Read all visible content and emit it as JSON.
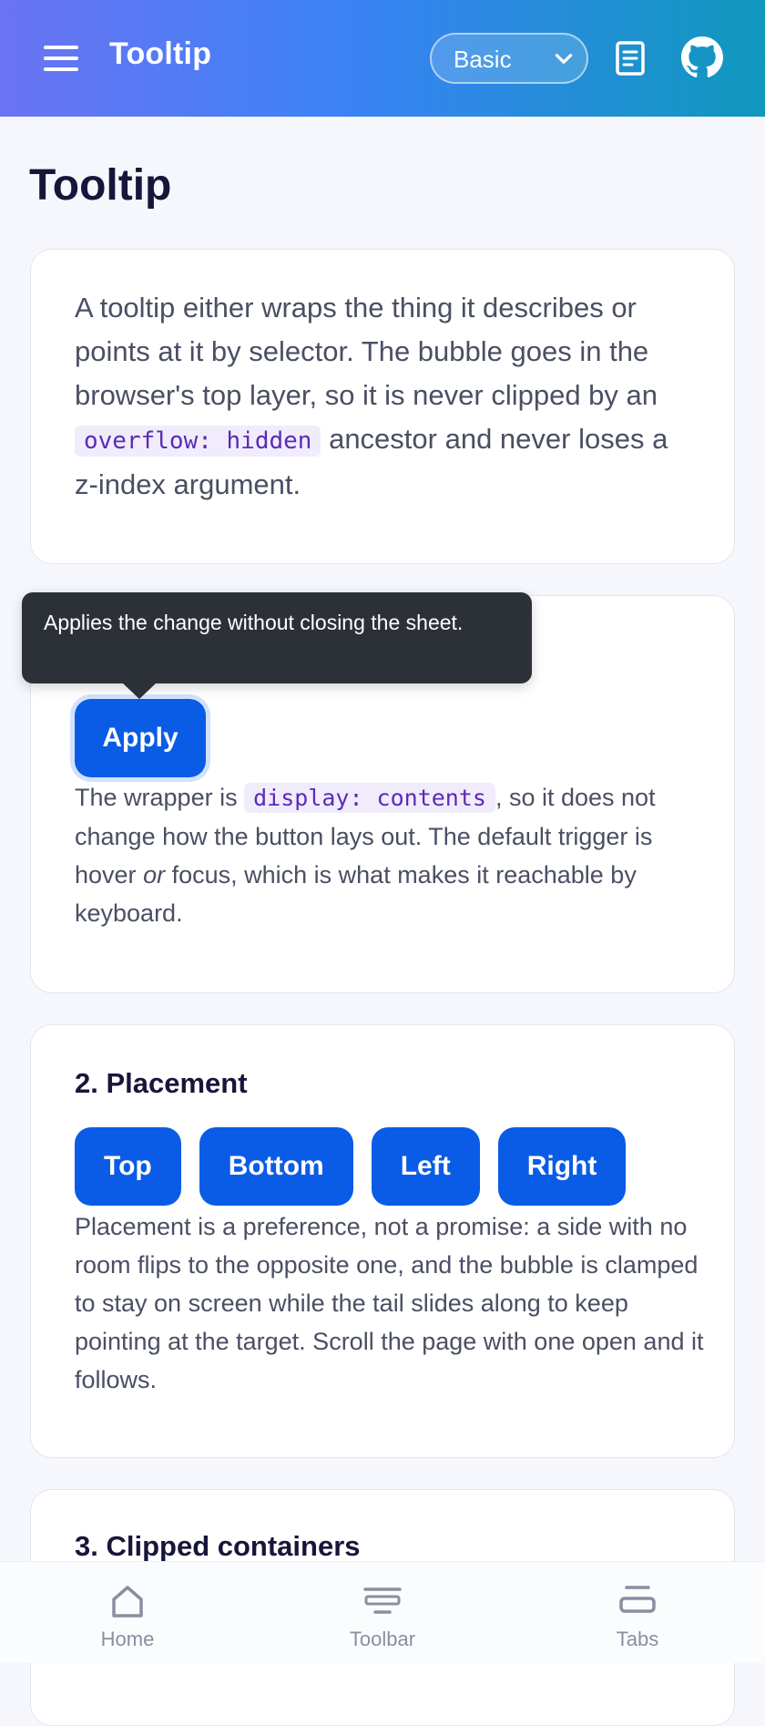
{
  "appbar": {
    "title": "Tooltip",
    "select_value": "Basic",
    "menu_icon": "hamburger-menu-icon",
    "docs_icon": "document-icon",
    "github_icon": "github-icon"
  },
  "page": {
    "title": "Tooltip"
  },
  "intro": {
    "text_1": "A tooltip either wraps the thing it describes or points at it by selector. The bubble goes in the browser's top layer, so it is never clipped by an",
    "code": "overflow: hidden",
    "text_2": "ancestor and never loses a z-index argument."
  },
  "section1": {
    "tooltip_text": "Applies the change without closing the sheet.",
    "apply_label": "Apply",
    "text_1": "The wrapper is",
    "code": "display: contents",
    "text_2": ", so it does not change how the button lays out. The default trigger is hover",
    "emphasis": "or",
    "text_3": "focus, which is what makes it reachable by keyboard."
  },
  "section2": {
    "title": "2. Placement",
    "buttons": [
      "Top",
      "Bottom",
      "Left",
      "Right"
    ],
    "text": "Placement is a preference, not a promise: a side with no room flips to the opposite one, and the bubble is clamped to stay on screen while the tail slides along to keep pointing at the target. Scroll the page with one open and it follows."
  },
  "section3": {
    "title": "3. Clipped containers"
  },
  "bottom_nav": {
    "items": [
      {
        "label": "Home",
        "icon": "home-icon"
      },
      {
        "label": "Toolbar",
        "icon": "toolbar-icon"
      },
      {
        "label": "Tabs",
        "icon": "tabs-icon"
      }
    ]
  }
}
